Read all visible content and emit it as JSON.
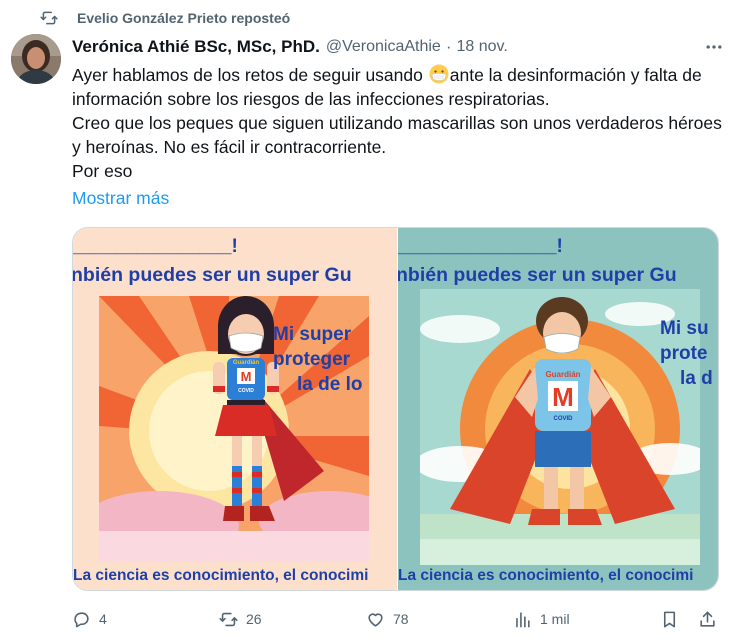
{
  "repost": {
    "icon": "repost-icon",
    "text": "Evelio González Prieto reposteó"
  },
  "author": {
    "name": "Verónica Athié BSc, MSc, PhD.",
    "handle": "@VeronicaAthie",
    "separator": "·",
    "time": "18 nov."
  },
  "tweet": {
    "line1_a": "Ayer hablamos de los retos de seguir usando",
    "line1_b": "ante la desinformación y falta de información sobre los riesgos de las infecciones respiratorias.",
    "line2": "Creo que los peques que siguen utilizando mascarillas son unos verdaderos héroes y heroínas. No es fácil ir contracorriente.",
    "line3": "Por eso",
    "show_more": "Mostrar más"
  },
  "media": {
    "left": {
      "blank": "_______________!",
      "heading": "nbién puedes ser un super Gu",
      "power_1": "Mi super",
      "power_2": "proteger",
      "power_3": "la de lo",
      "badge_title": "Guardián",
      "badge_letter": "M",
      "badge_sub": "COVID",
      "footer": "La ciencia es conocimiento, el conocimi"
    },
    "right": {
      "blank": "_______________!",
      "heading": "nbién puedes ser un super Gu",
      "power_1": "Mi su",
      "power_2": "prote",
      "power_3": "la d",
      "badge_title": "Guardián",
      "badge_letter": "M",
      "badge_sub": "COVID",
      "footer": "La ciencia es conocimiento, el conocimi"
    }
  },
  "actions": {
    "reply": {
      "icon": "reply-icon",
      "count": "4"
    },
    "repost": {
      "icon": "repost-icon",
      "count": "26"
    },
    "like": {
      "icon": "heart-icon",
      "count": "78"
    },
    "views": {
      "icon": "views-icon",
      "count": "1 mil"
    },
    "bookmark": {
      "icon": "bookmark-icon"
    },
    "share": {
      "icon": "share-icon"
    }
  },
  "colors": {
    "link": "#1d9bf0",
    "secondary_text": "#536471",
    "text": "#0f1419",
    "poster_blue": "#1f3fa8"
  }
}
